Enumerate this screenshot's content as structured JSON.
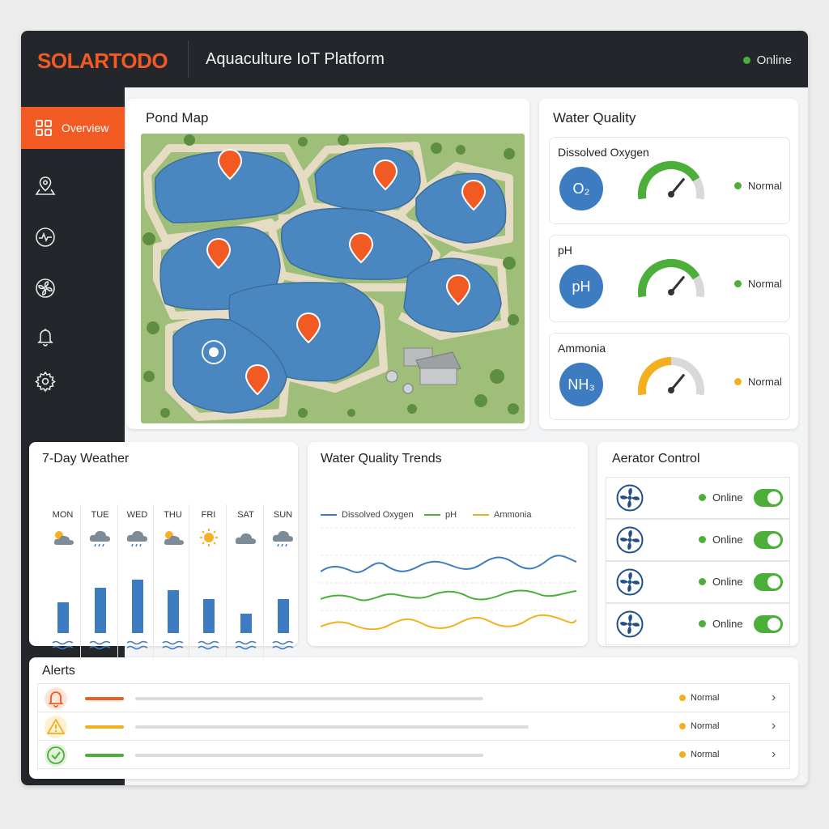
{
  "header": {
    "logo": "SOLARTODO",
    "title": "Aquaculture IoT Platform",
    "status": "Online"
  },
  "sidebar": {
    "items": [
      {
        "label": "Overview",
        "icon": "grid-icon",
        "active": true
      },
      {
        "label": "",
        "icon": "map-pin-icon"
      },
      {
        "label": "",
        "icon": "activity-icon"
      },
      {
        "label": "",
        "icon": "fan-icon"
      },
      {
        "label": "",
        "icon": "bell-icon"
      },
      {
        "label": "",
        "icon": "gear-icon"
      }
    ]
  },
  "pond_map": {
    "title": "Pond Map"
  },
  "water_quality": {
    "title": "Water Quality",
    "metrics": [
      {
        "label": "Dissolved Oxygen",
        "icon_text": "O₂",
        "status": "Normal",
        "level": 0.8,
        "color": "#4caf3a"
      },
      {
        "label": "pH",
        "icon_text": "pH",
        "status": "Normal",
        "level": 0.8,
        "color": "#4caf3a"
      },
      {
        "label": "Ammonia",
        "icon_text": "NH₃",
        "status": "Normal",
        "level": 0.5,
        "color": "#f2b01e"
      }
    ]
  },
  "weather": {
    "title": "7-Day Weather",
    "days": [
      {
        "name": "MON",
        "icon": "partly-cloudy-icon",
        "level": 0.42
      },
      {
        "name": "TUE",
        "icon": "rain-icon",
        "level": 0.62
      },
      {
        "name": "WED",
        "icon": "rain-icon",
        "level": 0.73
      },
      {
        "name": "THU",
        "icon": "partly-cloudy-icon",
        "level": 0.59
      },
      {
        "name": "FRI",
        "icon": "sun-icon",
        "level": 0.47
      },
      {
        "name": "SAT",
        "icon": "cloud-icon",
        "level": 0.27
      },
      {
        "name": "SUN",
        "icon": "rain-icon",
        "level": 0.47
      }
    ]
  },
  "trends": {
    "title": "Water Quality Trends",
    "legend": [
      {
        "name": "Dissolved Oxygen",
        "color": "#3e7cc2"
      },
      {
        "name": "pH",
        "color": "#4caf3a"
      },
      {
        "name": "Ammonia",
        "color": "#f2b01e"
      }
    ]
  },
  "aerators": {
    "title": "Aerator Control",
    "items": [
      {
        "status": "Online",
        "on": true
      },
      {
        "status": "Online",
        "on": true
      },
      {
        "status": "Online",
        "on": true
      },
      {
        "status": "Online",
        "on": true
      }
    ]
  },
  "alerts": {
    "title": "Alerts",
    "items": [
      {
        "icon": "bell-icon",
        "color": "#f15a22",
        "status": "Normal"
      },
      {
        "icon": "warning-icon",
        "color": "#f2b01e",
        "status": "Normal"
      },
      {
        "icon": "check-icon",
        "color": "#4caf3a",
        "status": "Normal"
      }
    ]
  }
}
